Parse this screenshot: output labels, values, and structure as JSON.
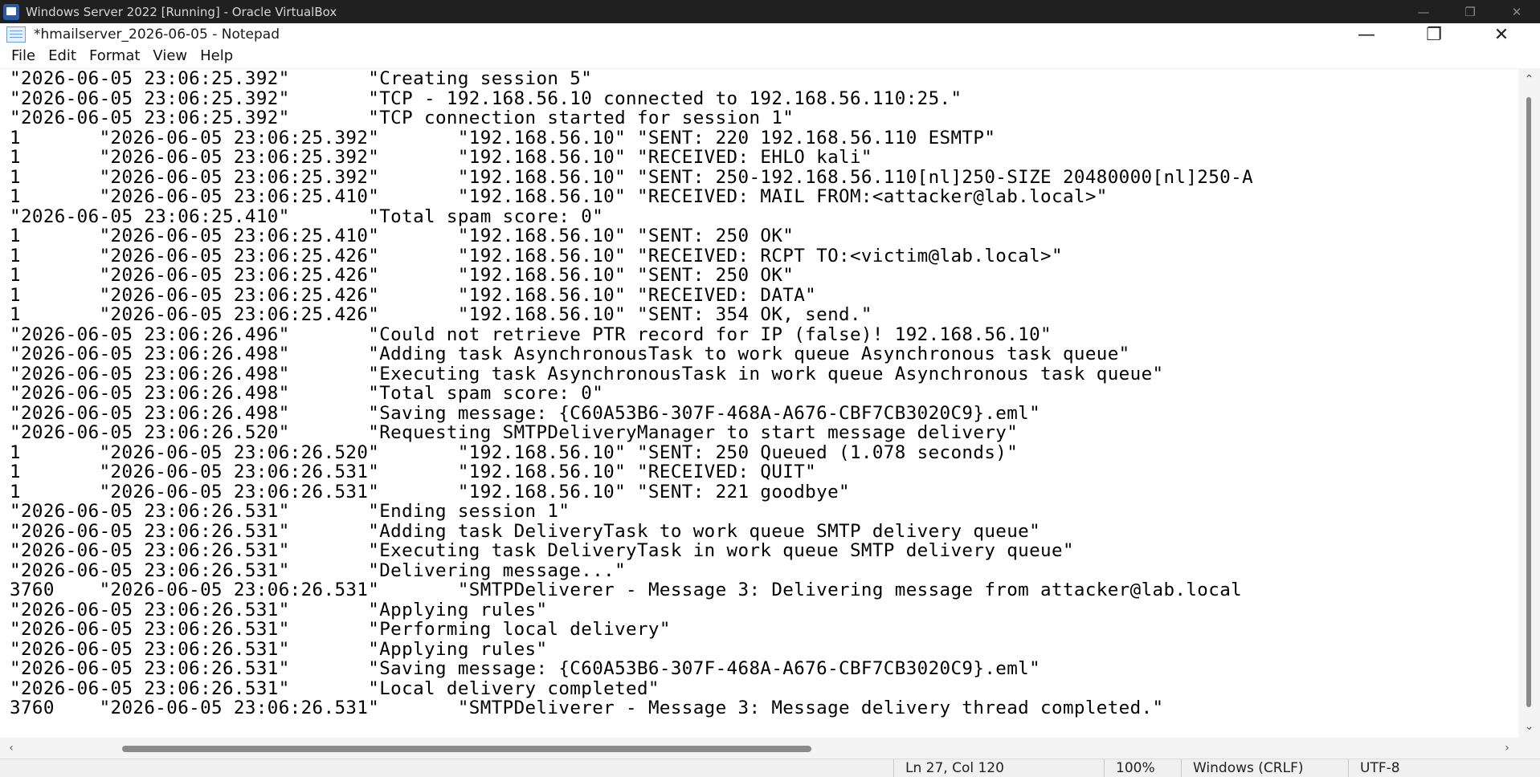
{
  "vbox": {
    "title": "Windows Server 2022 [Running] - Oracle VirtualBox",
    "minimize": "—",
    "restore": "❐",
    "close": "✕"
  },
  "notepad": {
    "title": "*hmailserver_2026-06-05 - Notepad",
    "minimize": "—",
    "restore": "❐",
    "close": "✕"
  },
  "menu": [
    "File",
    "Edit",
    "Format",
    "View",
    "Help"
  ],
  "content": "\"2026-06-05 23:06:25.392\"\t\"Creating session 5\"\n\"2026-06-05 23:06:25.392\"\t\"TCP - 192.168.56.10 connected to 192.168.56.110:25.\"\n\"2026-06-05 23:06:25.392\"\t\"TCP connection started for session 1\"\n1\t\"2026-06-05 23:06:25.392\"\t\"192.168.56.10\"\t\"SENT: 220 192.168.56.110 ESMTP\"\n1\t\"2026-06-05 23:06:25.392\"\t\"192.168.56.10\"\t\"RECEIVED: EHLO kali\"\n1\t\"2026-06-05 23:06:25.392\"\t\"192.168.56.10\"\t\"SENT: 250-192.168.56.110[nl]250-SIZE 20480000[nl]250-A\n1\t\"2026-06-05 23:06:25.410\"\t\"192.168.56.10\"\t\"RECEIVED: MAIL FROM:<attacker@lab.local>\"\n\"2026-06-05 23:06:25.410\"\t\"Total spam score: 0\"\n1\t\"2026-06-05 23:06:25.410\"\t\"192.168.56.10\"\t\"SENT: 250 OK\"\n1\t\"2026-06-05 23:06:25.426\"\t\"192.168.56.10\"\t\"RECEIVED: RCPT TO:<victim@lab.local>\"\n1\t\"2026-06-05 23:06:25.426\"\t\"192.168.56.10\"\t\"SENT: 250 OK\"\n1\t\"2026-06-05 23:06:25.426\"\t\"192.168.56.10\"\t\"RECEIVED: DATA\"\n1\t\"2026-06-05 23:06:25.426\"\t\"192.168.56.10\"\t\"SENT: 354 OK, send.\"\n\"2026-06-05 23:06:26.496\"\t\"Could not retrieve PTR record for IP (false)! 192.168.56.10\"\n\"2026-06-05 23:06:26.498\"\t\"Adding task AsynchronousTask to work queue Asynchronous task queue\"\n\"2026-06-05 23:06:26.498\"\t\"Executing task AsynchronousTask in work queue Asynchronous task queue\"\n\"2026-06-05 23:06:26.498\"\t\"Total spam score: 0\"\n\"2026-06-05 23:06:26.498\"\t\"Saving message: {C60A53B6-307F-468A-A676-CBF7CB3020C9}.eml\"\n\"2026-06-05 23:06:26.520\"\t\"Requesting SMTPDeliveryManager to start message delivery\"\n1\t\"2026-06-05 23:06:26.520\"\t\"192.168.56.10\"\t\"SENT: 250 Queued (1.078 seconds)\"\n1\t\"2026-06-05 23:06:26.531\"\t\"192.168.56.10\"\t\"RECEIVED: QUIT\"\n1\t\"2026-06-05 23:06:26.531\"\t\"192.168.56.10\"\t\"SENT: 221 goodbye\"\n\"2026-06-05 23:06:26.531\"\t\"Ending session 1\"\n\"2026-06-05 23:06:26.531\"\t\"Adding task DeliveryTask to work queue SMTP delivery queue\"\n\"2026-06-05 23:06:26.531\"\t\"Executing task DeliveryTask in work queue SMTP delivery queue\"\n\"2026-06-05 23:06:26.531\"\t\"Delivering message...\"\n3760\t\"2026-06-05 23:06:26.531\"\t\"SMTPDeliverer - Message 3: Delivering message from attacker@lab.local\n\"2026-06-05 23:06:26.531\"\t\"Applying rules\"\n\"2026-06-05 23:06:26.531\"\t\"Performing local delivery\"\n\"2026-06-05 23:06:26.531\"\t\"Applying rules\"\n\"2026-06-05 23:06:26.531\"\t\"Saving message: {C60A53B6-307F-468A-A676-CBF7CB3020C9}.eml\"\n\"2026-06-05 23:06:26.531\"\t\"Local delivery completed\"\n3760\t\"2026-06-05 23:06:26.531\"\t\"SMTPDeliverer - Message 3: Message delivery thread completed.\"",
  "scroll": {
    "up": "⌃",
    "down": "⌄",
    "left": "‹",
    "right": "›"
  },
  "status": {
    "position": "Ln 27, Col 120",
    "zoom": "100%",
    "line_ending": "Windows (CRLF)",
    "encoding": "UTF-8"
  }
}
